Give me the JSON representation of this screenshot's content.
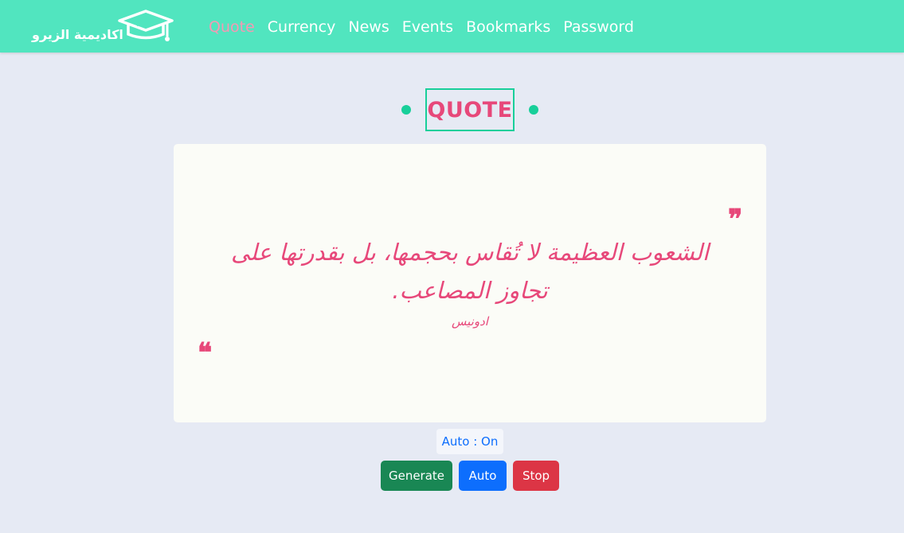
{
  "header": {
    "brand_name": "اكاديمية الزيرو",
    "brand_icon": "graduation-cap-icon",
    "nav": [
      {
        "label": "Quote",
        "active": true
      },
      {
        "label": "Currency",
        "active": false
      },
      {
        "label": "News",
        "active": false
      },
      {
        "label": "Events",
        "active": false
      },
      {
        "label": "Bookmarks",
        "active": false
      },
      {
        "label": "Password",
        "active": false
      }
    ]
  },
  "page": {
    "title": "QUOTE"
  },
  "quote": {
    "text": "الشعوب العظيمة لا تُقاس بحجمها، بل بقدرتها على تجاوز المصاعب.",
    "author": "ادونيس",
    "open_mark": "❞",
    "close_mark": "❝"
  },
  "controls": {
    "auto_status": "Auto : On",
    "generate_label": "Generate",
    "auto_label": "Auto",
    "stop_label": "Stop"
  },
  "colors": {
    "navbar": "#51e5bf",
    "accent_pink": "#e7487a",
    "accent_green": "#18cf9a",
    "generate": "#198754",
    "auto": "#0d6efd",
    "stop": "#dc3545"
  }
}
